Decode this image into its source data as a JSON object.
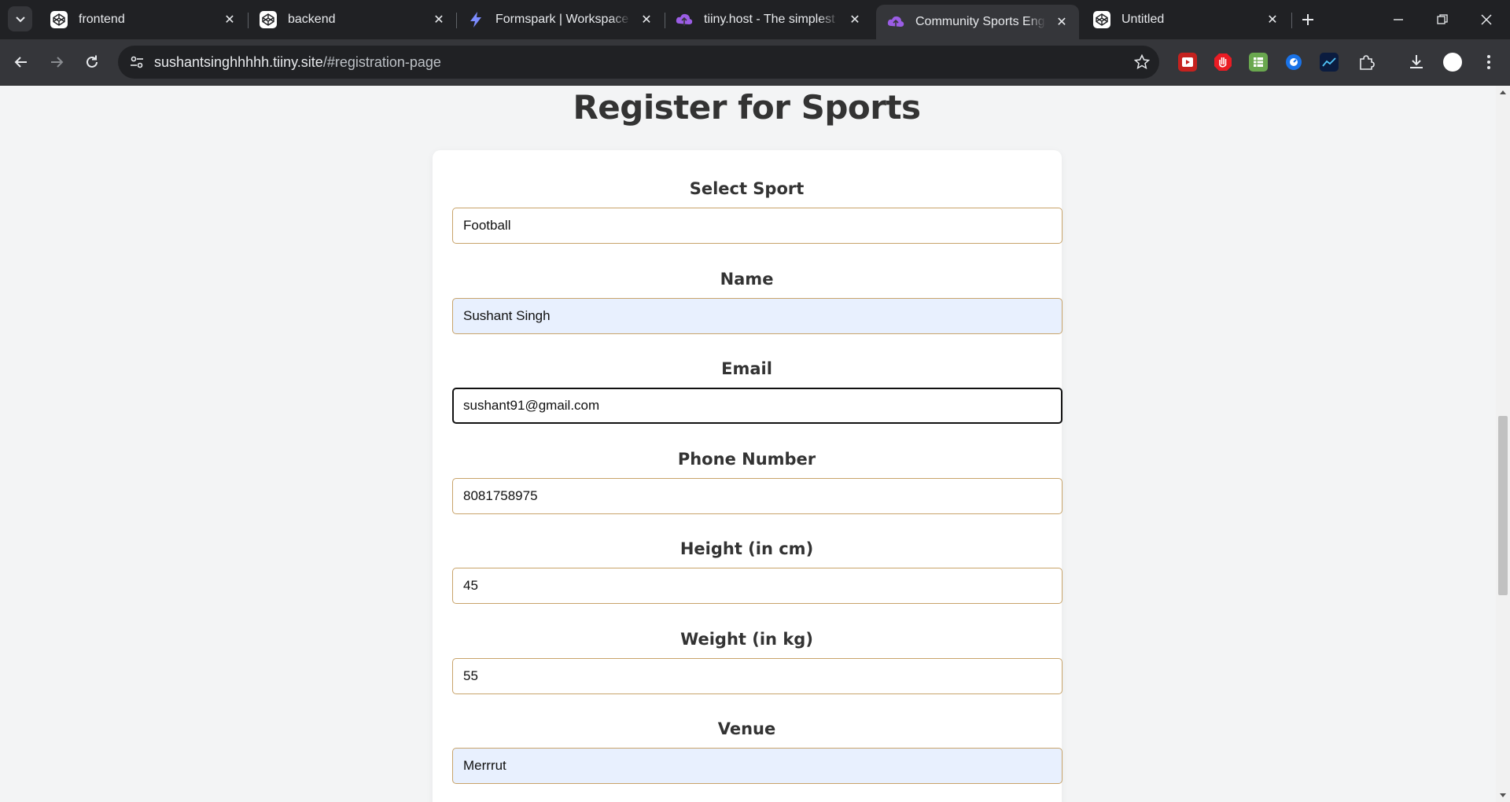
{
  "browser": {
    "tabs": [
      {
        "title": "frontend",
        "icon": "codepen-icon"
      },
      {
        "title": "backend",
        "icon": "codepen-icon"
      },
      {
        "title": "Formspark | Workspace",
        "icon": "lightning-icon"
      },
      {
        "title": "tiiny.host - The simplest way",
        "icon": "cloud-icon"
      },
      {
        "title": "Community Sports Engagement",
        "icon": "cloud-icon",
        "active": true
      },
      {
        "title": "Untitled",
        "icon": "codepen-icon"
      }
    ],
    "url": {
      "host": "sushantsinghhhhh.tiiny.site",
      "path": "/#registration-page"
    }
  },
  "page": {
    "title": "Register for Sports",
    "fields": [
      {
        "label": "Select Sport",
        "value": "Football",
        "state": "normal"
      },
      {
        "label": "Name",
        "value": "Sushant Singh",
        "state": "autofill"
      },
      {
        "label": "Email",
        "value": "sushant91@gmail.com",
        "state": "focused"
      },
      {
        "label": "Phone Number",
        "value": "8081758975",
        "state": "normal"
      },
      {
        "label": "Height (in cm)",
        "value": "45",
        "state": "normal"
      },
      {
        "label": "Weight (in kg)",
        "value": "55",
        "state": "normal"
      },
      {
        "label": "Venue",
        "value": "Merrrut",
        "state": "autofill"
      }
    ]
  },
  "colors": {
    "input_border": "#c8a36a",
    "autofill_bg": "#e8f0fe",
    "card_bg": "#ffffff",
    "page_bg": "#f3f4f5",
    "heading": "#333333"
  }
}
